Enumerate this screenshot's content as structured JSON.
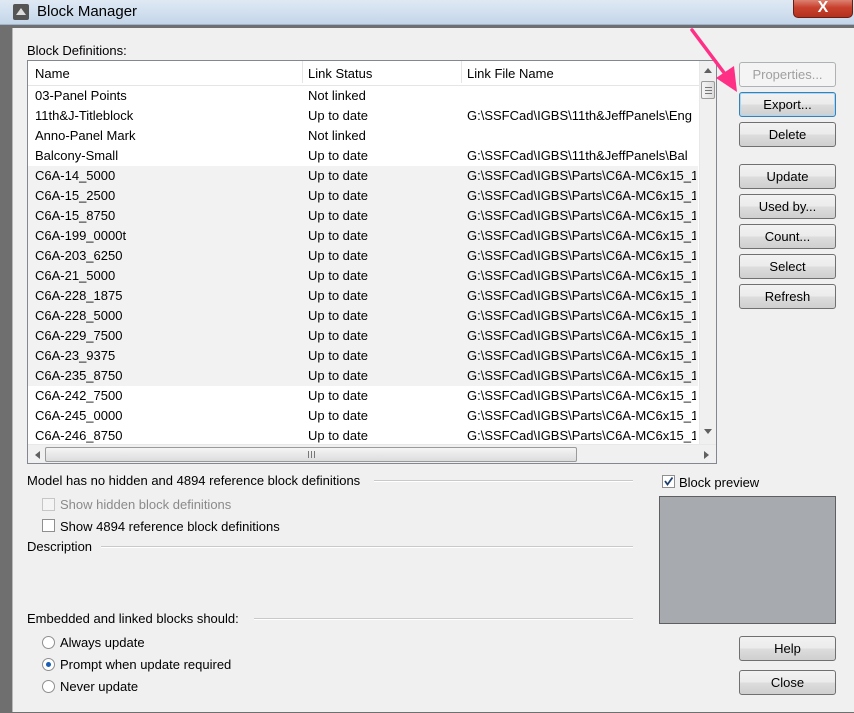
{
  "window": {
    "title": "Block Manager",
    "close_label": "X"
  },
  "definitions_label": "Block Definitions:",
  "columns": [
    "Name",
    "Link Status",
    "Link File Name"
  ],
  "rows": [
    {
      "name": "03-Panel Points",
      "status": "Not linked",
      "file": ""
    },
    {
      "name": "11th&J-Titleblock",
      "status": "Up to date",
      "file": "G:\\SSFCad\\IGBS\\11th&JeffPanels\\Eng"
    },
    {
      "name": "Anno-Panel Mark",
      "status": "Not linked",
      "file": ""
    },
    {
      "name": "Balcony-Small",
      "status": "Up to date",
      "file": "G:\\SSFCad\\IGBS\\11th&JeffPanels\\Bal"
    },
    {
      "name": "C6A-14_5000",
      "status": "Up to date",
      "file": "G:\\SSFCad\\IGBS\\Parts\\C6A-MC6x15_1"
    },
    {
      "name": "C6A-15_2500",
      "status": "Up to date",
      "file": "G:\\SSFCad\\IGBS\\Parts\\C6A-MC6x15_1"
    },
    {
      "name": "C6A-15_8750",
      "status": "Up to date",
      "file": "G:\\SSFCad\\IGBS\\Parts\\C6A-MC6x15_1"
    },
    {
      "name": "C6A-199_0000t",
      "status": "Up to date",
      "file": "G:\\SSFCad\\IGBS\\Parts\\C6A-MC6x15_1"
    },
    {
      "name": "C6A-203_6250",
      "status": "Up to date",
      "file": "G:\\SSFCad\\IGBS\\Parts\\C6A-MC6x15_1"
    },
    {
      "name": "C6A-21_5000",
      "status": "Up to date",
      "file": "G:\\SSFCad\\IGBS\\Parts\\C6A-MC6x15_1"
    },
    {
      "name": "C6A-228_1875",
      "status": "Up to date",
      "file": "G:\\SSFCad\\IGBS\\Parts\\C6A-MC6x15_1"
    },
    {
      "name": "C6A-228_5000",
      "status": "Up to date",
      "file": "G:\\SSFCad\\IGBS\\Parts\\C6A-MC6x15_1"
    },
    {
      "name": "C6A-229_7500",
      "status": "Up to date",
      "file": "G:\\SSFCad\\IGBS\\Parts\\C6A-MC6x15_1"
    },
    {
      "name": "C6A-23_9375",
      "status": "Up to date",
      "file": "G:\\SSFCad\\IGBS\\Parts\\C6A-MC6x15_1"
    },
    {
      "name": "C6A-235_8750",
      "status": "Up to date",
      "file": "G:\\SSFCad\\IGBS\\Parts\\C6A-MC6x15_1"
    },
    {
      "name": "C6A-242_7500",
      "status": "Up to date",
      "file": "G:\\SSFCad\\IGBS\\Parts\\C6A-MC6x15_1"
    },
    {
      "name": "C6A-245_0000",
      "status": "Up to date",
      "file": "G:\\SSFCad\\IGBS\\Parts\\C6A-MC6x15_1"
    },
    {
      "name": "C6A-246_8750",
      "status": "Up to date",
      "file": "G:\\SSFCad\\IGBS\\Parts\\C6A-MC6x15_1"
    }
  ],
  "buttons": {
    "properties": "Properties...",
    "export": "Export...",
    "delete": "Delete",
    "update": "Update",
    "used_by": "Used by...",
    "count": "Count...",
    "select": "Select",
    "refresh": "Refresh",
    "help": "Help",
    "close": "Close"
  },
  "model_info": "Model has no hidden and 4894 reference block definitions",
  "show_hidden": "Show hidden block definitions",
  "show_reference": "Show 4894 reference block definitions",
  "description_label": "Description",
  "block_preview_label": "Block preview",
  "embedded_label": "Embedded and linked blocks should:",
  "update_options": [
    "Always update",
    "Prompt when update required",
    "Never update"
  ],
  "selected_update_option": "Prompt when update required",
  "colors": {
    "annotation_arrow": "#ff2f86",
    "preview_bg": "#a7abb0"
  }
}
